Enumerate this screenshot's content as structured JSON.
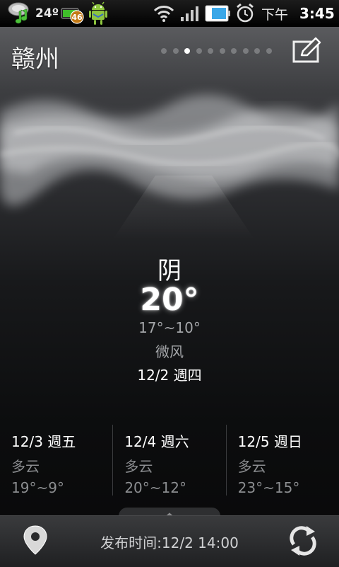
{
  "status_bar": {
    "temperature": "24º",
    "battery_level": "46",
    "time_prefix": "下午",
    "time": "3:45"
  },
  "header": {
    "city": "赣州",
    "page_count": 10,
    "active_page": 2
  },
  "current": {
    "condition": "阴",
    "temperature": "20°",
    "range": "17°~10°",
    "wind": "微风",
    "date": "12/2 週四"
  },
  "forecast": [
    {
      "day": "12/3 週五",
      "condition": "多云",
      "range": "19°~9°"
    },
    {
      "day": "12/4 週六",
      "condition": "多云",
      "range": "20°~12°"
    },
    {
      "day": "12/5 週日",
      "condition": "多云",
      "range": "23°~15°"
    }
  ],
  "footer": {
    "publish_time": "发布时间:12/2 14:00"
  },
  "icons": {
    "music": "music-weather-icon",
    "battery": "battery-icon",
    "android": "android-icon",
    "wifi": "wifi-icon",
    "signal": "signal-icon",
    "phone_battery": "phone-battery-icon",
    "alarm": "alarm-icon",
    "edit": "edit-icon",
    "location": "location-pin-icon",
    "refresh": "refresh-icon"
  },
  "colors": {
    "battery_green": "#3fbf2a",
    "text_dim": "#a4a6a9",
    "accent_white": "#ffffff"
  }
}
